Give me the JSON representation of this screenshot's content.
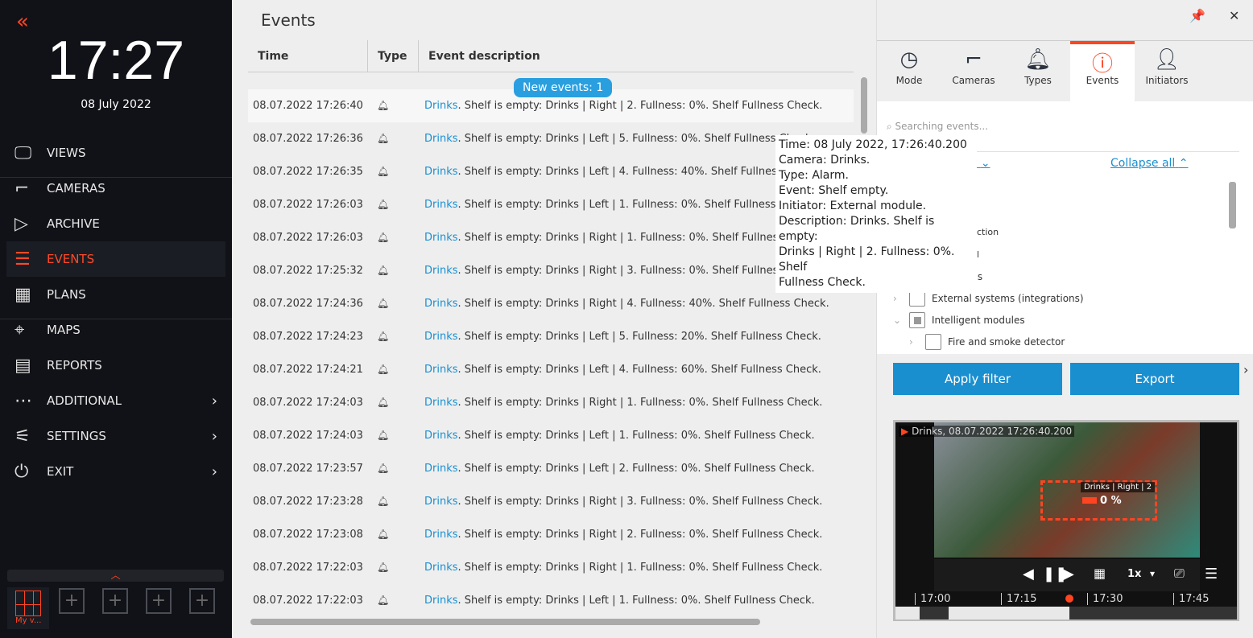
{
  "sidebar": {
    "clock": "17:27",
    "date": "08 July 2022",
    "collapse_icon": "«",
    "items": [
      {
        "label": "VIEWS",
        "icon": "views-icon"
      },
      {
        "label": "CAMERAS",
        "icon": "camera-icon"
      },
      {
        "label": "ARCHIVE",
        "icon": "archive-icon"
      },
      {
        "label": "EVENTS",
        "icon": "events-icon",
        "active": true
      },
      {
        "label": "PLANS",
        "icon": "plans-icon"
      },
      {
        "label": "MAPS",
        "icon": "maps-icon"
      },
      {
        "label": "REPORTS",
        "icon": "reports-icon"
      },
      {
        "label": "ADDITIONAL",
        "icon": "more-icon",
        "submenu": true
      },
      {
        "label": "SETTINGS",
        "icon": "settings-icon",
        "submenu": true
      },
      {
        "label": "EXIT",
        "icon": "power-icon",
        "submenu": true
      }
    ],
    "layout_label": "My v..."
  },
  "main": {
    "title": "Events",
    "columns": [
      "Time",
      "Type",
      "Event description"
    ],
    "new_events": "New events: 1",
    "rows": [
      {
        "time": "08.07.2022 17:26:40",
        "camera": "Drinks",
        "desc": ". Shelf is empty: Drinks | Right | 2. Fullness: 0%. Shelf Fullness Check."
      },
      {
        "time": "08.07.2022 17:26:36",
        "camera": "Drinks",
        "desc": ". Shelf is empty: Drinks | Left | 5. Fullness: 0%. Shelf Fullness Check."
      },
      {
        "time": "08.07.2022 17:26:35",
        "camera": "Drinks",
        "desc": ". Shelf is empty: Drinks | Left | 4. Fullness: 40%. Shelf Fullness Check."
      },
      {
        "time": "08.07.2022 17:26:03",
        "camera": "Drinks",
        "desc": ". Shelf is empty: Drinks | Left | 1. Fullness: 0%. Shelf Fullness Check."
      },
      {
        "time": "08.07.2022 17:26:03",
        "camera": "Drinks",
        "desc": ". Shelf is empty: Drinks | Right | 1. Fullness: 0%. Shelf Fullness Check."
      },
      {
        "time": "08.07.2022 17:25:32",
        "camera": "Drinks",
        "desc": ". Shelf is empty: Drinks | Right | 3. Fullness: 0%. Shelf Fullness Check."
      },
      {
        "time": "08.07.2022 17:24:36",
        "camera": "Drinks",
        "desc": ". Shelf is empty: Drinks | Right | 4. Fullness: 40%. Shelf Fullness Check."
      },
      {
        "time": "08.07.2022 17:24:23",
        "camera": "Drinks",
        "desc": ". Shelf is empty: Drinks | Left | 5. Fullness: 20%. Shelf Fullness Check."
      },
      {
        "time": "08.07.2022 17:24:21",
        "camera": "Drinks",
        "desc": ". Shelf is empty: Drinks | Left | 4. Fullness: 60%. Shelf Fullness Check."
      },
      {
        "time": "08.07.2022 17:24:03",
        "camera": "Drinks",
        "desc": ". Shelf is empty: Drinks | Right | 1. Fullness: 0%. Shelf Fullness Check."
      },
      {
        "time": "08.07.2022 17:24:03",
        "camera": "Drinks",
        "desc": ". Shelf is empty: Drinks | Left | 1. Fullness: 0%. Shelf Fullness Check."
      },
      {
        "time": "08.07.2022 17:23:57",
        "camera": "Drinks",
        "desc": ". Shelf is empty: Drinks | Left | 2. Fullness: 0%. Shelf Fullness Check."
      },
      {
        "time": "08.07.2022 17:23:28",
        "camera": "Drinks",
        "desc": ". Shelf is empty: Drinks | Right | 3. Fullness: 0%. Shelf Fullness Check."
      },
      {
        "time": "08.07.2022 17:23:08",
        "camera": "Drinks",
        "desc": ". Shelf is empty: Drinks | Right | 2. Fullness: 0%. Shelf Fullness Check."
      },
      {
        "time": "08.07.2022 17:22:03",
        "camera": "Drinks",
        "desc": ". Shelf is empty: Drinks | Right | 1. Fullness: 0%. Shelf Fullness Check."
      },
      {
        "time": "08.07.2022 17:22:03",
        "camera": "Drinks",
        "desc": ". Shelf is empty: Drinks | Left | 1. Fullness: 0%. Shelf Fullness Check."
      }
    ]
  },
  "tooltip": [
    "Time: 08 July 2022, 17:26:40.200",
    "Camera: Drinks.",
    "Type: Alarm.",
    "Event: Shelf empty.",
    "Initiator: External module.",
    "Description: Drinks. Shelf is empty:",
    "Drinks | Right | 2. Fullness: 0%. Shelf",
    "Fullness Check."
  ],
  "right": {
    "tabs": [
      "Mode",
      "Cameras",
      "Types",
      "Events",
      "Initiators"
    ],
    "active_tab": "Events",
    "search_placeholder": "Searching events...",
    "expand_all_partial": "all",
    "collapse_all": "Collapse all",
    "hidden_fragments": [
      "ction",
      "l"
    ],
    "tree": [
      "Signals",
      "External systems (integrations)",
      "Intelligent modules",
      "Fire and smoke detector"
    ],
    "apply": "Apply filter",
    "export": "Export",
    "video": {
      "title": "Drinks, 08.07.2022 17:26:40.200",
      "zone_label": "Drinks | Right | 2",
      "zone_value": "0 %",
      "speed": "1x",
      "ticks": [
        "17:00",
        "17:15",
        "17:30",
        "17:45"
      ]
    }
  },
  "colors": {
    "accent": "#ff4422",
    "link": "#1a8fd0"
  }
}
